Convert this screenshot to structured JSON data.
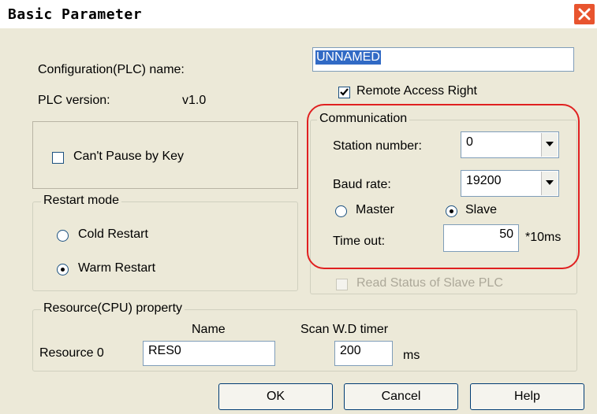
{
  "window": {
    "title": "Basic Parameter",
    "close_icon": "close-icon"
  },
  "config": {
    "name_label": "Configuration(PLC) name:",
    "name_value": "UNNAMED",
    "version_label": "PLC version:",
    "version_value": "v1.0"
  },
  "remote_access": {
    "label": "Remote Access Right",
    "checked": true
  },
  "pause": {
    "label": "Can't Pause by Key",
    "checked": false
  },
  "restart": {
    "title": "Restart mode",
    "cold_label": "Cold Restart",
    "warm_label": "Warm Restart",
    "selected": "warm"
  },
  "communication": {
    "title": "Communication",
    "station_label": "Station number:",
    "station_value": "0",
    "baud_label": "Baud rate:",
    "baud_value": "19200",
    "master_label": "Master",
    "slave_label": "Slave",
    "selected_mode": "slave",
    "timeout_label": "Time out:",
    "timeout_value": "50",
    "timeout_unit": "*10ms"
  },
  "read_status": {
    "label": "Read Status of Slave PLC",
    "checked": false,
    "enabled": false
  },
  "resource": {
    "title": "Resource(CPU) property",
    "name_header": "Name",
    "scan_header": "Scan W.D timer",
    "row_label": "Resource 0",
    "name_value": "RES0",
    "scan_value": "200",
    "scan_unit": "ms"
  },
  "buttons": {
    "ok": "OK",
    "cancel": "Cancel",
    "help": "Help"
  },
  "annotation_color": "#e02020"
}
